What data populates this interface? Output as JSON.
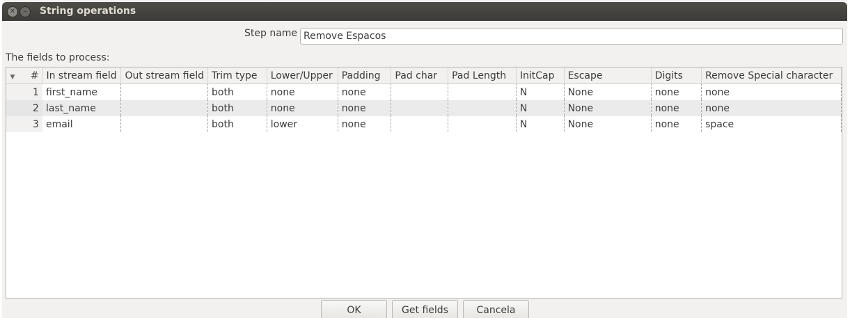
{
  "window": {
    "title": "String operations"
  },
  "step_name": {
    "label": "Step name",
    "value": "Remove Espacos"
  },
  "fields_label": "The fields to process:",
  "grid": {
    "num_header": "#",
    "columns": [
      "In stream field",
      "Out stream field",
      "Trim type",
      "Lower/Upper",
      "Padding",
      "Pad char",
      "Pad Length",
      "InitCap",
      "Escape",
      "Digits",
      "Remove Special character"
    ],
    "rows": [
      {
        "num": "1",
        "cells": [
          "first_name",
          "",
          "both",
          "none",
          "none",
          "",
          "",
          "N",
          "None",
          "none",
          "none"
        ]
      },
      {
        "num": "2",
        "cells": [
          "last_name",
          "",
          "both",
          "none",
          "none",
          "",
          "",
          "N",
          "None",
          "none",
          "none"
        ]
      },
      {
        "num": "3",
        "cells": [
          "email",
          "",
          "both",
          "lower",
          "none",
          "",
          "",
          "N",
          "None",
          "none",
          "space"
        ]
      }
    ]
  },
  "buttons": {
    "ok": "OK",
    "get_fields": "Get fields",
    "cancel": "Cancela"
  }
}
